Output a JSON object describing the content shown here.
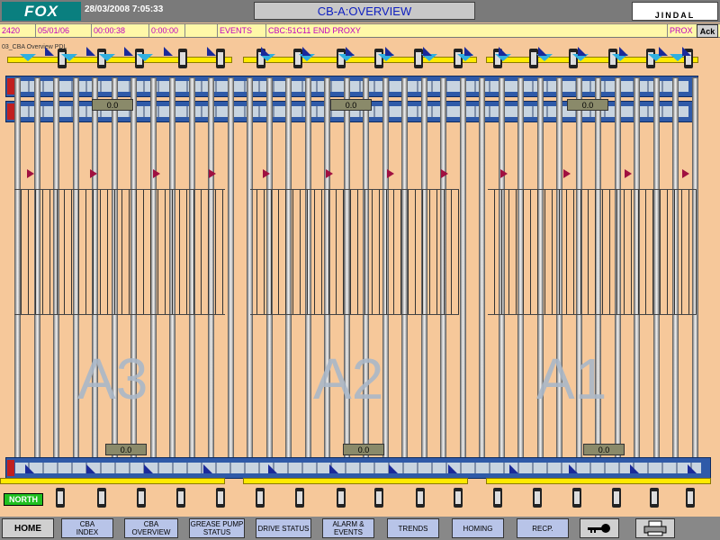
{
  "header": {
    "logo": "FOX",
    "datetime": "28/03/2008 7:05:33",
    "title": "CB-A:OVERVIEW",
    "brand": "JINDAL"
  },
  "alarm_bar": {
    "cells": [
      "2420",
      "05/01/06",
      "00:00:38",
      "0:00:00",
      "",
      "EVENTS",
      "CBC:51C11 END PROXY",
      "PROX"
    ],
    "ack_label": "Ack"
  },
  "overview_label": "03_CBA Overview PDL",
  "readouts_top": [
    "0.0",
    "0.0",
    "0.0"
  ],
  "readouts_bottom": [
    "0.0",
    "0.0",
    "0.0"
  ],
  "zones": [
    "A3",
    "A2",
    "A1"
  ],
  "north_label": "NORTH",
  "nav": {
    "home": "HOME",
    "cba_index": "CBA\nINDEX",
    "cba_overview": "CBA\nOVERVIEW",
    "grease_pump": "GREASE PUMP\nSTATUS",
    "drive_status": "DRIVE STATUS",
    "alarm_events": "ALARM &\nEVENTS",
    "trends": "TRENDS",
    "homing": "HOMING",
    "recp": "RECP.",
    "key_icon": "key-icon",
    "printer_icon": "printer-icon"
  },
  "colors": {
    "background": "#f6c89a",
    "header": "#7a7a7a",
    "logo_bg": "#0a7f7f",
    "title_text": "#1020c0",
    "alarm_bg": "#fff8a8",
    "alarm_text": "#c000c0",
    "conveyor": "#2f5aa8",
    "rail": "#ffea00",
    "north": "#20c020",
    "nav_button": "#b8c4e8"
  }
}
